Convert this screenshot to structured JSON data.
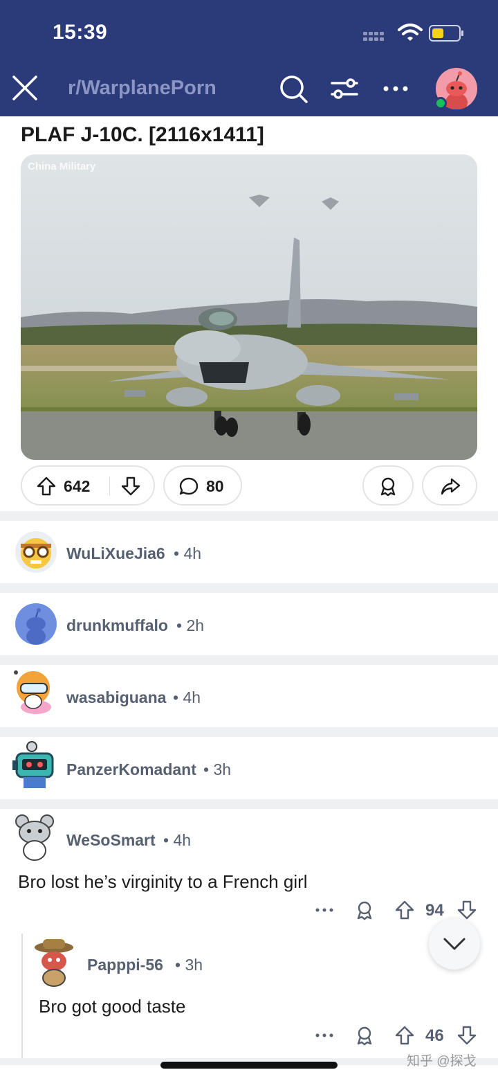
{
  "status_bar": {
    "time": "15:39"
  },
  "header": {
    "subreddit": "r/WarplanePorn"
  },
  "post": {
    "title": "PLAF J-10C. [2116x1411]",
    "image_watermark": "China Military",
    "upvotes": "642",
    "comments": "80"
  },
  "comments": [
    {
      "user": "WuLiXueJia6",
      "time": "• 4h"
    },
    {
      "user": "drunkmuffalo",
      "time": "• 2h"
    },
    {
      "user": "wasabiguana",
      "time": "• 4h"
    },
    {
      "user": "PanzerKomadant",
      "time": "• 3h"
    },
    {
      "user": "WeSoSmart",
      "time": "• 4h",
      "body": "Bro lost he’s virginity to a French girl",
      "score": "94"
    },
    {
      "user": "Papppi-56",
      "time": "• 3h",
      "body": "Bro got good taste",
      "score": "46"
    }
  ],
  "watermark": "知乎 @探戈",
  "colors": {
    "header_bg": "#2b3a78",
    "online": "#19c05a",
    "divider": "#eef0f2"
  }
}
